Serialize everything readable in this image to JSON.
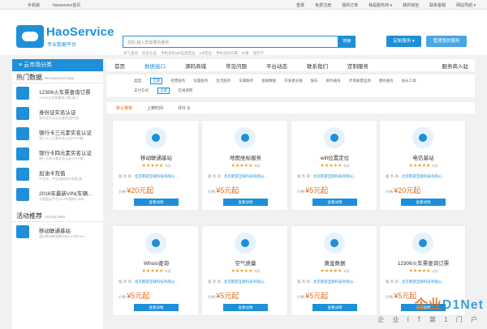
{
  "topbar": {
    "left": [
      "手机版",
      "haoservice首页"
    ],
    "right": [
      "登录",
      "免费注册",
      "我的订单",
      "我是服务商 ▾",
      "我的钱包",
      "联系客服",
      "网站导航 ▾"
    ]
  },
  "header": {
    "brand": "HaoService",
    "brand_sub": "专业数据平台",
    "search_placeholder": "您好,输入您需要的服务",
    "search_button": "搜索",
    "hotwords": [
      "天气查询",
      "实名认证",
      "手机号码wifi信息定位",
      "wifi定位",
      "手机号码归属",
      "IP类",
      "银行卡"
    ],
    "custom_button": "定制服务 ▾",
    "manage_button": "管理我的服务"
  },
  "sidebar": {
    "category_label": "≡ 云市场分类",
    "hot_title": "热门数据",
    "hot_title_en": "Recommend Data",
    "hot_items": [
      {
        "title": "12306火车票查询订票",
        "desc": "12306火车票查询订票,接口"
      },
      {
        "title": "身份证实名认证",
        "desc": "身份证实名认证查询,提供身"
      },
      {
        "title": "银行卡三元素实名认证",
        "desc": "银行卡三元素实名认证HTTP服"
      },
      {
        "title": "银行卡四元素实名认证",
        "desc": "银行卡四元素实名认证HTTP服"
      },
      {
        "title": "加油卡充值",
        "desc": "中石化、中石油加油卡充值,移"
      },
      {
        "title": "2016年最新VIN(车辆...",
        "desc": "大数据云平台2016年最新VIN码"
      }
    ],
    "activity_title": "活动推荐",
    "activity_title_en": "Activity Data",
    "activity_items": [
      {
        "title": "移动联通基站",
        "desc": "通过移动联通基站的LAC和CELL"
      }
    ]
  },
  "nav": {
    "items": [
      "首页",
      "数据接口",
      "源码商城",
      "常见问题",
      "平台动态",
      "联系我们",
      "定制服务"
    ],
    "active_index": 1,
    "right": "服务商入驻"
  },
  "filters": {
    "type_label": "类型:",
    "types": [
      "全部",
      "经营服务",
      "位置服务",
      "生活服务",
      "车辆服务",
      "金融数据",
      "开发者必备",
      "娱乐",
      "即时通讯",
      "环境质量监测",
      "便民服务",
      "站长工具"
    ],
    "pay_label": "支付方式:",
    "pays": [
      "全部",
      "在线调用"
    ]
  },
  "sort": [
    "默认推荐",
    "上架时间",
    "评分 ⇅"
  ],
  "cards": [
    {
      "name": "移动联通基站",
      "stars": "★★★★★",
      "score": "5分",
      "provider_label": "服 务 商 :",
      "provider": "北京鹤游互联科技有限公...",
      "price_label": "价格:",
      "price": "¥20元起",
      "button": "查看详情"
    },
    {
      "name": "地图坐标服务",
      "stars": "★★★★★",
      "score": "5分",
      "provider_label": "服 务 商 :",
      "provider": "北京鹤游互联科技有限公...",
      "price_label": "价格:",
      "price": "¥5元起",
      "button": "查看详情"
    },
    {
      "name": "wifi位置定位",
      "stars": "★★★★★",
      "score": "5分",
      "provider_label": "服 务 商 :",
      "provider": "北京鹤游互联科技有限公...",
      "price_label": "价格:",
      "price": "¥5元起",
      "button": "查看详情"
    },
    {
      "name": "电信基站",
      "stars": "★★★★★",
      "score": "5分",
      "provider_label": "服 务 商 :",
      "provider": "北京鹤游互联科技有限公...",
      "price_label": "价格:",
      "price": "¥20元起",
      "button": "查看详情"
    },
    {
      "name": "Whois查询",
      "stars": "★★★★★",
      "score": "5分",
      "provider_label": "服 务 商 :",
      "provider": "北京鹤游互联科技有限公...",
      "price_label": "价格:",
      "price": "¥5元起",
      "button": "查看详情"
    },
    {
      "name": "空气质量",
      "stars": "★★★★★",
      "score": "5分",
      "provider_label": "服 务 商 :",
      "provider": "北京鹤游互联科技有限公...",
      "price_label": "价格:",
      "price": "¥5元起",
      "button": "查看详情"
    },
    {
      "name": "黄金数据",
      "stars": "★★★★★",
      "score": "5分",
      "provider_label": "服 务 商 :",
      "provider": "北京鹤游互联科技有限公...",
      "price_label": "价格:",
      "price": "¥5元起",
      "button": "查看详情"
    },
    {
      "name": "12306火车票查询订票",
      "stars": "★★★★★",
      "score": "5分",
      "provider_label": "服 务 商 :",
      "provider": "北京鹤游互联科技有限公...",
      "price_label": "价格:",
      "price": "¥5元起",
      "button": "查看详情"
    }
  ],
  "watermark": {
    "main": "企业",
    "net": "D1Net",
    "sub": "企 业 I T 第 1 门 户"
  },
  "colors": {
    "accent": "#1e8fd8",
    "price": "#e06a1b",
    "star": "#f0a020"
  }
}
